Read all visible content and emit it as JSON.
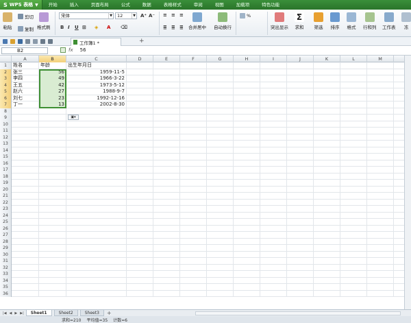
{
  "app": {
    "logo": "S",
    "name": "WPS 表格"
  },
  "menu_tabs": [
    "开始",
    "插入",
    "页面布局",
    "公式",
    "数据",
    "表格样式",
    "审阅",
    "视图",
    "加载项",
    "特色功能"
  ],
  "ribbon": {
    "paste": "粘贴",
    "cut": "剪切",
    "copy": "复制",
    "format_painter": "格式刷",
    "font_name": "宋体",
    "font_size": "12",
    "bold": "B",
    "italic": "I",
    "underline": "U",
    "merge_center": "合并居中",
    "wrap_text": "自动换行",
    "percent": "%",
    "highlight_dup": "突出显示",
    "sum": "求和",
    "filter": "筛选",
    "sort": "排序",
    "format": "格式",
    "row_col": "行和列",
    "worksheet": "工作表",
    "freeze": "冻"
  },
  "document_tab": "工作簿1 *",
  "formula_bar": {
    "cell_ref": "B2",
    "fx": "fx",
    "value": "56"
  },
  "columns": [
    "A",
    "B",
    "C",
    "D",
    "E",
    "F",
    "G",
    "H",
    "I",
    "J",
    "K",
    "L",
    "M"
  ],
  "rows": [
    [
      "姓名",
      "年龄",
      "出生年月日"
    ],
    [
      "张三",
      "56",
      "1959-11-5"
    ],
    [
      "李四",
      "49",
      "1966-3-22"
    ],
    [
      "王五",
      "42",
      "1973-5-12"
    ],
    [
      "赵六",
      "27",
      "1988-9-7"
    ],
    [
      "刘七",
      "23",
      "1992-12-16"
    ],
    [
      "丁一",
      "13",
      "2002-8-30"
    ]
  ],
  "row_count": 36,
  "sheets": [
    "Sheet1",
    "Sheet2",
    "Sheet3"
  ],
  "status": {
    "sum": "求和=210",
    "avg": "平均值=35",
    "count": "计数=6"
  },
  "colors": {
    "accent": "#3f8f34",
    "menubar": "#2f7d2f",
    "selection": "#d9ecd2"
  }
}
